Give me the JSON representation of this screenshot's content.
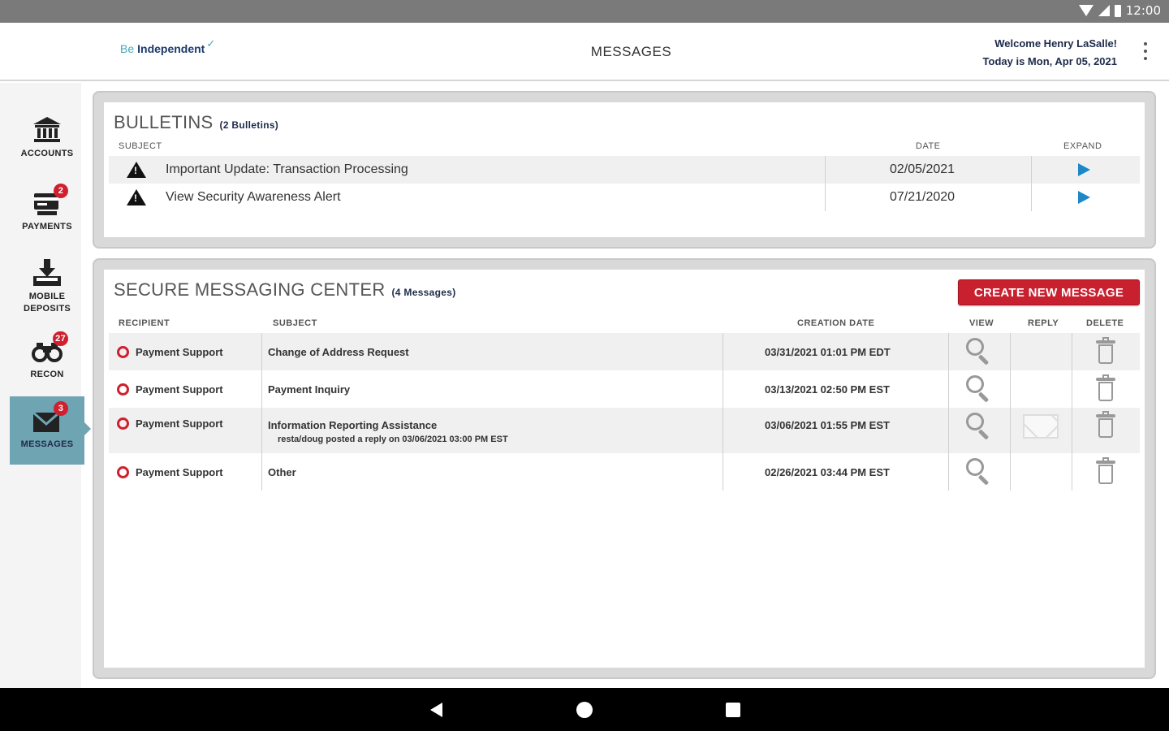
{
  "status_bar": {
    "time": "12:00"
  },
  "header": {
    "logo_be": "Be",
    "logo_independent": "Independent",
    "title": "MESSAGES",
    "welcome": "Welcome Henry LaSalle!",
    "today": "Today is Mon, Apr 05, 2021"
  },
  "sidebar": {
    "items": [
      {
        "label": "ACCOUNTS",
        "icon": "bank-icon",
        "badge": null
      },
      {
        "label": "PAYMENTS",
        "icon": "payments-icon",
        "badge": "2"
      },
      {
        "label_line1": "MOBILE",
        "label_line2": "DEPOSITS",
        "icon": "download-tray-icon",
        "badge": null
      },
      {
        "label": "RECON",
        "icon": "binoculars-icon",
        "badge": "27"
      },
      {
        "label": "MESSAGES",
        "icon": "envelope-icon",
        "badge": "3",
        "active": true
      }
    ]
  },
  "bulletins": {
    "title": "BULLETINS",
    "count": "(2 Bulletins)",
    "headers": {
      "subject": "SUBJECT",
      "date": "DATE",
      "expand": "EXPAND"
    },
    "rows": [
      {
        "subject": "Important Update: Transaction Processing",
        "date": "02/05/2021"
      },
      {
        "subject": "View Security Awareness Alert",
        "date": "07/21/2020"
      }
    ]
  },
  "messaging": {
    "title": "SECURE MESSAGING CENTER",
    "count": "(4 Messages)",
    "create_button": "CREATE NEW MESSAGE",
    "headers": {
      "recipient": "RECIPIENT",
      "subject": "SUBJECT",
      "creation_date": "CREATION DATE",
      "view": "VIEW",
      "reply": "REPLY",
      "delete": "DELETE"
    },
    "rows": [
      {
        "recipient": "Payment Support",
        "subject": "Change of Address Request",
        "note": "",
        "date": "03/31/2021 01:01 PM EDT"
      },
      {
        "recipient": "Payment Support",
        "subject": "Payment Inquiry",
        "note": "",
        "date": "03/13/2021 02:50 PM EST"
      },
      {
        "recipient": "Payment Support",
        "subject": "Information Reporting Assistance",
        "note": "resta/doug posted a reply on 03/06/2021 03:00 PM EST",
        "date": "03/06/2021 01:55 PM EST"
      },
      {
        "recipient": "Payment Support",
        "subject": "Other",
        "note": "",
        "date": "02/26/2021 03:44 PM EST"
      }
    ]
  },
  "colors": {
    "accent_red": "#c8202f",
    "active_nav": "#6fa4b3",
    "expand_blue": "#1e88c7"
  }
}
